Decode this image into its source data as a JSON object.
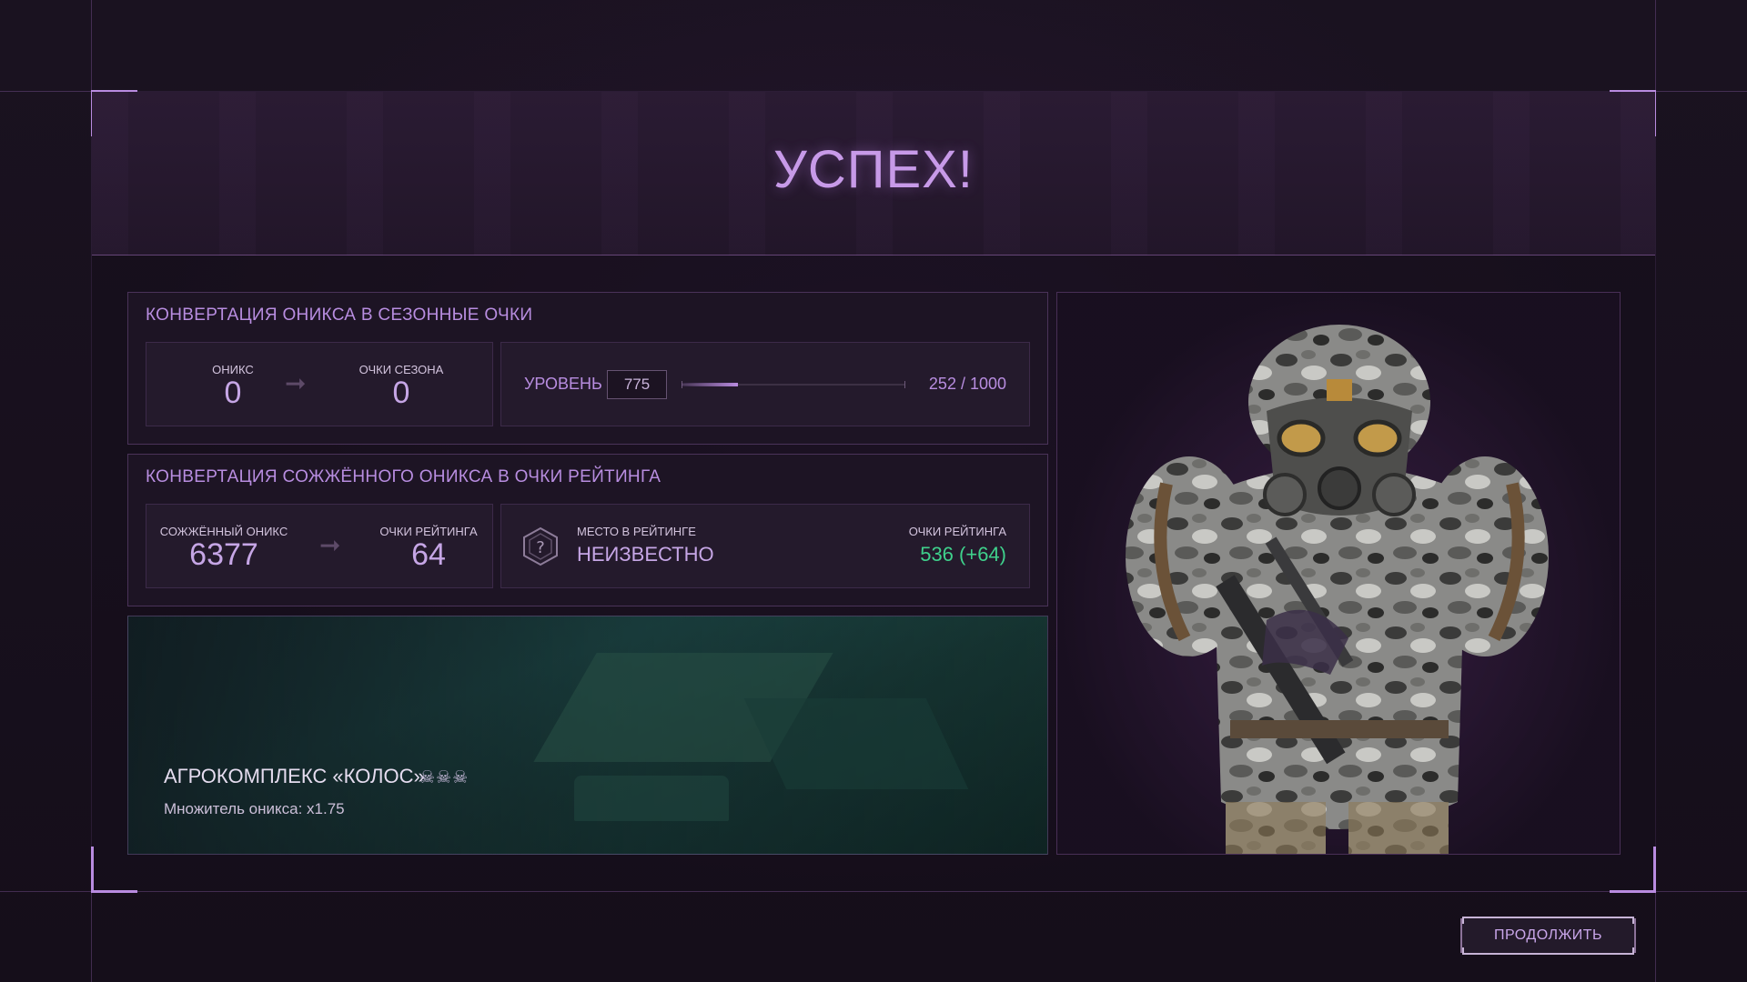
{
  "header": {
    "title": "УСПЕХ!"
  },
  "season_conversion": {
    "title": "КОНВЕРТАЦИЯ ОНИКСА В СЕЗОННЫЕ ОЧКИ",
    "onyx_label": "ОНИКС",
    "onyx_value": "0",
    "season_points_label": "ОЧКИ СЕЗОНА",
    "season_points_value": "0",
    "level_label": "УРОВЕНЬ",
    "level_value": "775",
    "progress_text": "252 / 1000",
    "progress_fraction": 0.252
  },
  "rating_conversion": {
    "title": "КОНВЕРТАЦИЯ СОЖЖЁННОГО ОНИКСА В ОЧКИ РЕЙТИНГА",
    "burned_onyx_label": "СОЖЖЁННЫЙ ОНИКС",
    "burned_onyx_value": "6377",
    "rating_points_label": "ОЧКИ РЕЙТИНГА",
    "rating_points_value": "64",
    "rank_place_label": "МЕСТО В РЕЙТИНГЕ",
    "rank_place_value": "НЕИЗВЕСТНО",
    "total_rating_label": "ОЧКИ РЕЙТИНГА",
    "total_rating_value": "536 (+64)"
  },
  "map": {
    "name": "АГРОКОМПЛЕКС «КОЛОС»",
    "difficulty_icons": "☠☠☠",
    "multiplier_label": "Множитель оникса:",
    "multiplier_value": "x1.75"
  },
  "footer": {
    "continue_label": "ПРОДОЛЖИТЬ"
  },
  "colors": {
    "accent": "#b98be0",
    "positive": "#3fd18c",
    "background": "#160f1c"
  }
}
